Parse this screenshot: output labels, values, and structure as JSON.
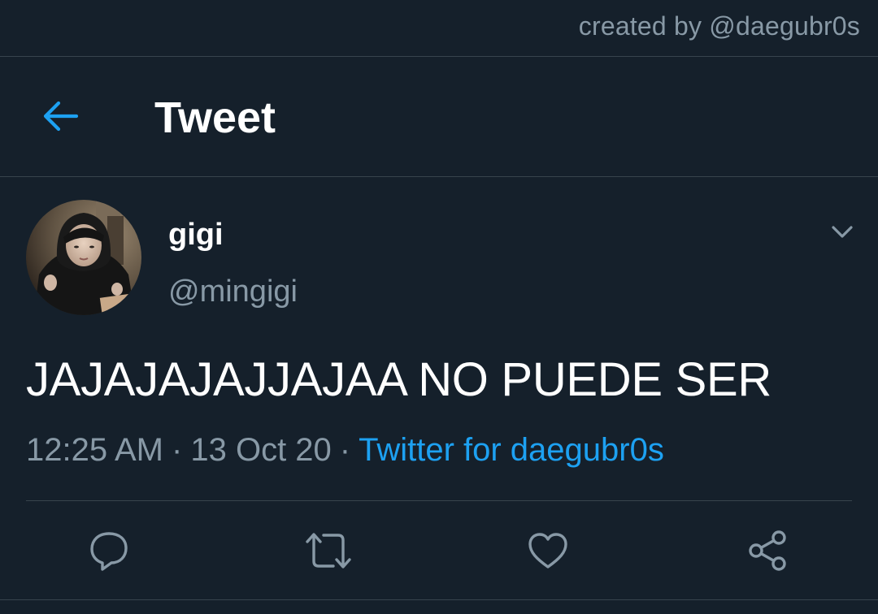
{
  "credit": "created by @daegubr0s",
  "header": {
    "title": "Tweet",
    "back_icon": "arrow-left-icon"
  },
  "tweet": {
    "display_name": "gigi",
    "handle": "@mingigi",
    "text": "JAJAJAJAJJAJAA NO PUEDE SER",
    "time": "12:25 AM",
    "date": "13 Oct 20",
    "separator": "·",
    "source": "Twitter for daegubr0s",
    "more_icon": "chevron-down-icon"
  },
  "actions": [
    {
      "name": "reply",
      "icon": "reply-icon"
    },
    {
      "name": "retweet",
      "icon": "retweet-icon"
    },
    {
      "name": "like",
      "icon": "heart-icon"
    },
    {
      "name": "share",
      "icon": "share-icon"
    }
  ],
  "colors": {
    "background": "#15202b",
    "accent": "#1da1f2",
    "secondary_text": "#8899a6",
    "divider": "#38444d",
    "icon": "#8899a6"
  }
}
